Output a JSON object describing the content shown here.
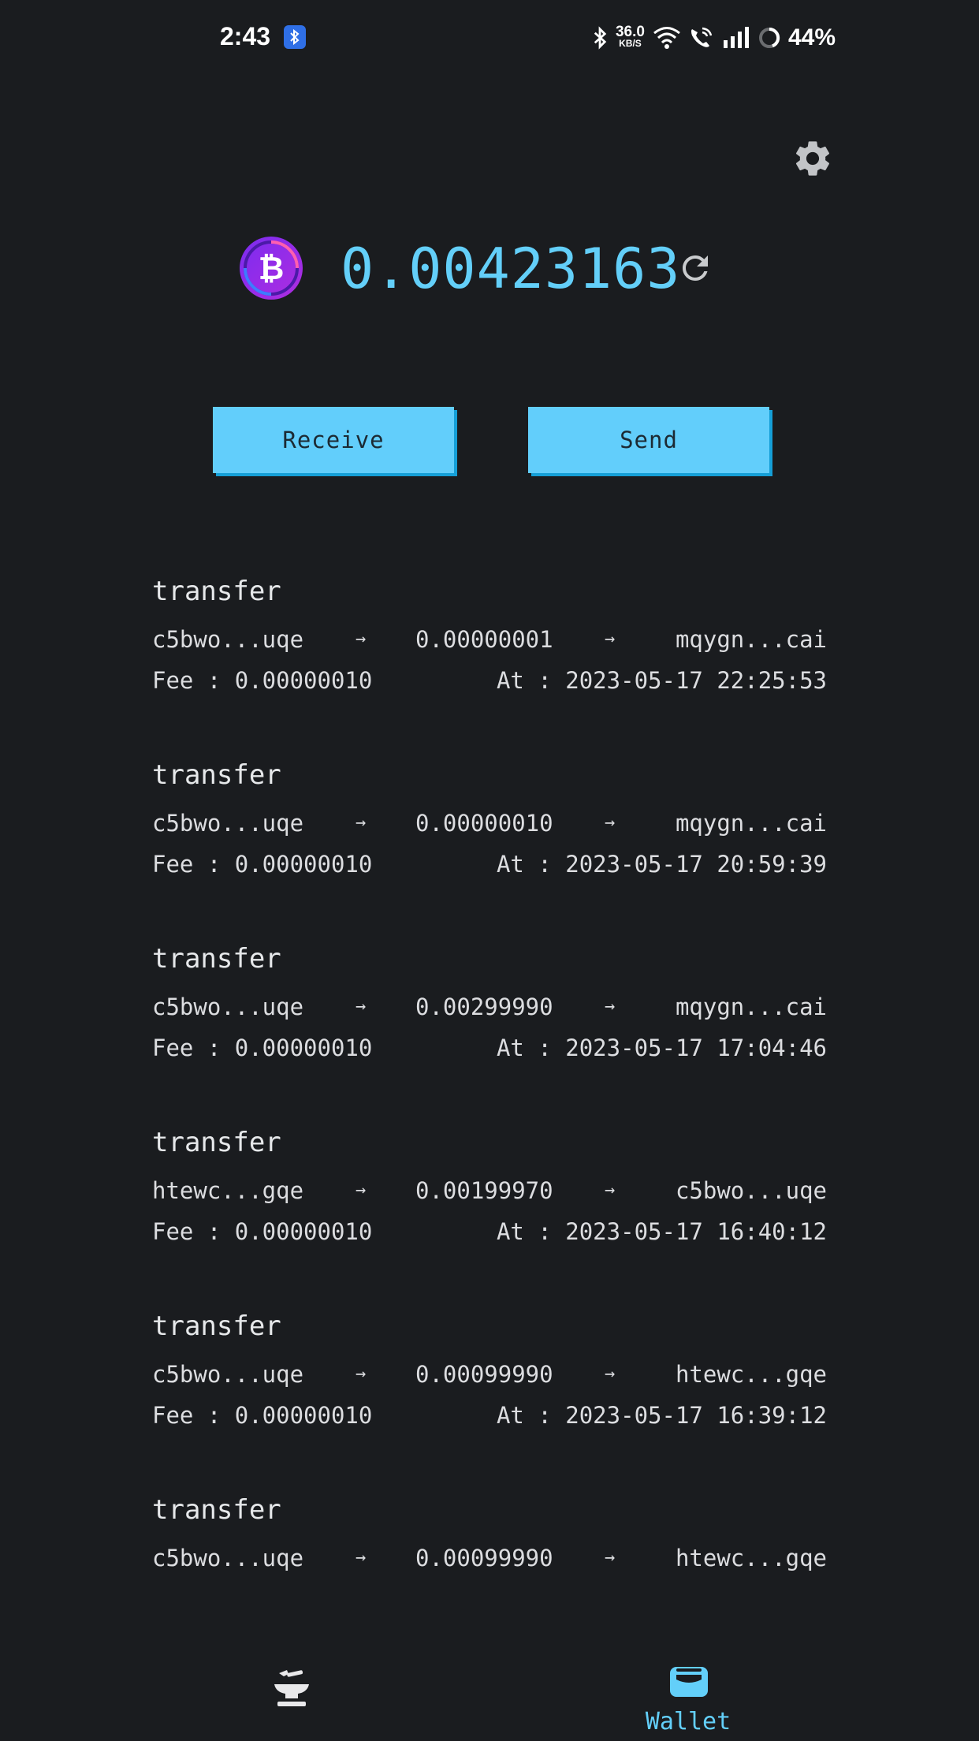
{
  "status_bar": {
    "time": "2:43",
    "net_speed_value": "36.0",
    "net_speed_unit": "KB/S",
    "battery": "44%"
  },
  "wallet": {
    "balance": "0.00423163",
    "receive_label": "Receive",
    "send_label": "Send"
  },
  "colors": {
    "accent": "#63cff9",
    "button": "#62cefb",
    "background": "#1a1c1f"
  },
  "transactions": [
    {
      "type": "transfer",
      "from": "c5bwo...uqe",
      "amount": "0.00000001",
      "to": "mqygn...cai",
      "fee": "Fee : 0.00000010",
      "at": "At : 2023-05-17 22:25:53"
    },
    {
      "type": "transfer",
      "from": "c5bwo...uqe",
      "amount": "0.00000010",
      "to": "mqygn...cai",
      "fee": "Fee : 0.00000010",
      "at": "At : 2023-05-17 20:59:39"
    },
    {
      "type": "transfer",
      "from": "c5bwo...uqe",
      "amount": "0.00299990",
      "to": "mqygn...cai",
      "fee": "Fee : 0.00000010",
      "at": "At : 2023-05-17 17:04:46"
    },
    {
      "type": "transfer",
      "from": "htewc...gqe",
      "amount": "0.00199970",
      "to": "c5bwo...uqe",
      "fee": "Fee : 0.00000010",
      "at": "At : 2023-05-17 16:40:12"
    },
    {
      "type": "transfer",
      "from": "c5bwo...uqe",
      "amount": "0.00099990",
      "to": "htewc...gqe",
      "fee": "Fee : 0.00000010",
      "at": "At : 2023-05-17 16:39:12"
    },
    {
      "type": "transfer",
      "from": "c5bwo...uqe",
      "amount": "0.00099990",
      "to": "htewc...gqe",
      "fee": "",
      "at": ""
    }
  ],
  "nav": {
    "wallet_label": "Wallet"
  },
  "icons": [
    "bluetooth-icon",
    "wifi-icon",
    "wifi-call-icon",
    "signal-icon",
    "battery-icon",
    "gear-icon",
    "bitcoin-icon",
    "refresh-icon",
    "arrow-right-icon",
    "anvil-icon",
    "wallet-icon"
  ]
}
